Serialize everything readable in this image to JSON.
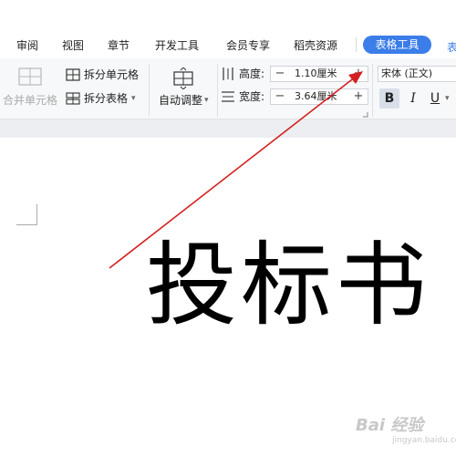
{
  "menu": {
    "items": [
      "审阅",
      "视图",
      "章节",
      "开发工具",
      "会员专享",
      "稻壳资源"
    ],
    "active_tab": "表格工具",
    "next_tab_partial": "表"
  },
  "ribbon": {
    "merge_cells": "合并单元格",
    "split_cells": "拆分单元格",
    "split_table": "拆分表格",
    "auto_adjust": "自动调整",
    "height_label": "高度:",
    "height_value": "1.10厘米",
    "width_label": "宽度:",
    "width_value": "3.64厘米",
    "minus": "−",
    "plus": "+",
    "font_name": "宋体 (正文)",
    "bold": "B",
    "italic": "I",
    "underline": "U"
  },
  "document": {
    "title": "投标书"
  },
  "watermark": {
    "text": "Bai 经验",
    "sub": "jingyan.baidu.com"
  },
  "colors": {
    "accent": "#3b7de9",
    "arrow": "#d42020"
  }
}
